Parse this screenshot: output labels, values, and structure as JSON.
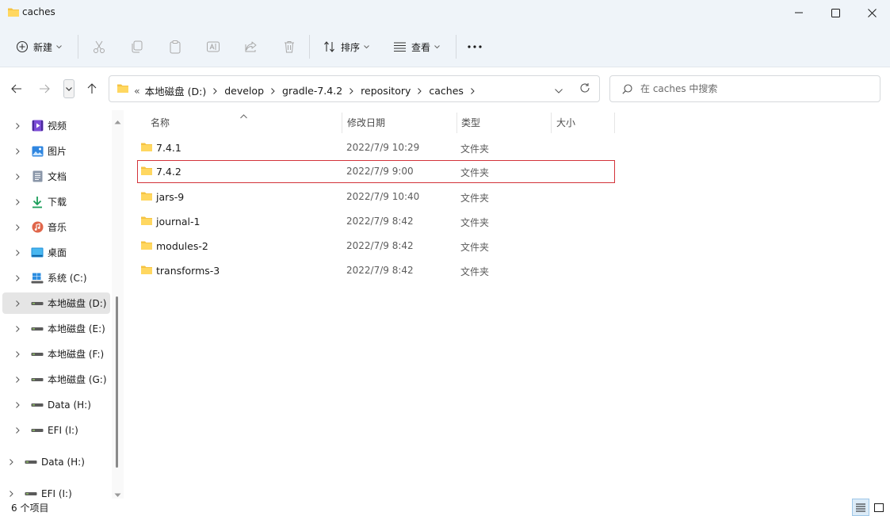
{
  "window": {
    "title": "caches",
    "controls": [
      "minimize-icon",
      "maximize-icon",
      "close-icon"
    ]
  },
  "toolbar": {
    "new_label": "新建",
    "sort_label": "排序",
    "view_label": "查看",
    "icons": [
      "cut-icon",
      "copy-icon",
      "paste-icon",
      "rename-icon",
      "share-icon",
      "delete-icon",
      "more-icon"
    ]
  },
  "address": {
    "overflow": "«",
    "crumbs": [
      "本地磁盘 (D:)",
      "develop",
      "gradle-7.4.2",
      "repository",
      "caches"
    ]
  },
  "search": {
    "placeholder": "在 caches 中搜索"
  },
  "sidebar": {
    "items": [
      {
        "label": "视频",
        "icon": "video-icon"
      },
      {
        "label": "图片",
        "icon": "pictures-icon"
      },
      {
        "label": "文档",
        "icon": "documents-icon"
      },
      {
        "label": "下载",
        "icon": "download-icon"
      },
      {
        "label": "音乐",
        "icon": "music-icon"
      },
      {
        "label": "桌面",
        "icon": "desktop-icon"
      },
      {
        "label": "系统 (C:)",
        "icon": "windows-drive-icon"
      },
      {
        "label": "本地磁盘 (D:)",
        "icon": "drive-icon",
        "selected": true
      },
      {
        "label": "本地磁盘 (E:)",
        "icon": "drive-icon"
      },
      {
        "label": "本地磁盘 (F:)",
        "icon": "drive-icon"
      },
      {
        "label": "本地磁盘 (G:)",
        "icon": "drive-icon"
      },
      {
        "label": "Data (H:)",
        "icon": "drive-icon"
      },
      {
        "label": "EFI (I:)",
        "icon": "drive-icon"
      },
      {
        "label": "Data (H:)",
        "icon": "drive-icon"
      },
      {
        "label": "EFI (I:)",
        "icon": "drive-icon"
      }
    ]
  },
  "filelist": {
    "columns": {
      "name": "名称",
      "modified": "修改日期",
      "type": "类型",
      "size": "大小"
    },
    "rows": [
      {
        "name": "7.4.1",
        "modified": "2022/7/9 10:29",
        "type": "文件夹"
      },
      {
        "name": "7.4.2",
        "modified": "2022/7/9 9:00",
        "type": "文件夹",
        "highlighted": true
      },
      {
        "name": "jars-9",
        "modified": "2022/7/9 10:40",
        "type": "文件夹"
      },
      {
        "name": "journal-1",
        "modified": "2022/7/9 8:42",
        "type": "文件夹"
      },
      {
        "name": "modules-2",
        "modified": "2022/7/9 8:42",
        "type": "文件夹"
      },
      {
        "name": "transforms-3",
        "modified": "2022/7/9 8:42",
        "type": "文件夹"
      }
    ]
  },
  "status": {
    "item_count": "6 个项目"
  },
  "colors": {
    "chrome_bg": "#eff4f9",
    "folder": "#f5c342",
    "highlight_border": "#d3333a",
    "selected_nav": "#e5e5e5"
  }
}
